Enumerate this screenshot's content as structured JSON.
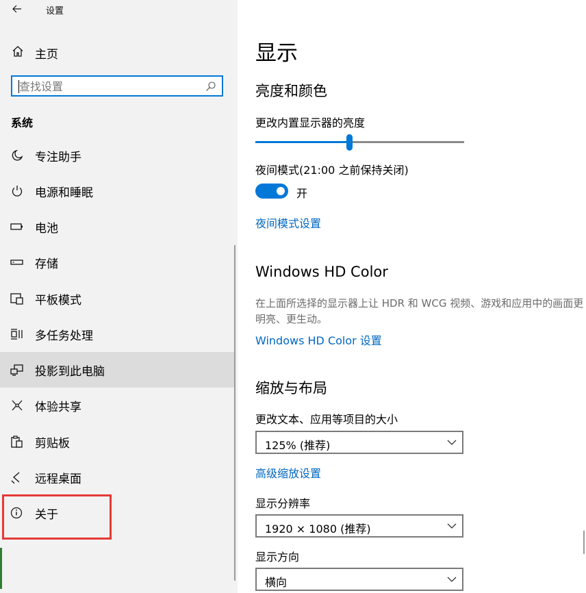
{
  "window": {
    "title": "设置",
    "back_icon": "back-arrow-icon"
  },
  "sidebar": {
    "home_label": "主页",
    "search_placeholder": "查找设置",
    "section_title": "系统",
    "items": [
      {
        "label": "专注助手",
        "icon": "moon-icon"
      },
      {
        "label": "电源和睡眠",
        "icon": "power-icon"
      },
      {
        "label": "电池",
        "icon": "battery-icon"
      },
      {
        "label": "存储",
        "icon": "storage-icon"
      },
      {
        "label": "平板模式",
        "icon": "tablet-mode-icon"
      },
      {
        "label": "多任务处理",
        "icon": "multitasking-icon"
      },
      {
        "label": "投影到此电脑",
        "icon": "projecting-icon",
        "selected": true
      },
      {
        "label": "体验共享",
        "icon": "shared-experiences-icon"
      },
      {
        "label": "剪贴板",
        "icon": "clipboard-icon"
      },
      {
        "label": "远程桌面",
        "icon": "remote-desktop-icon"
      },
      {
        "label": "关于",
        "icon": "info-icon"
      }
    ],
    "highlight_color": "#e53935"
  },
  "main": {
    "page_title": "显示",
    "brightness_section": {
      "heading": "亮度和颜色",
      "slider_label": "更改内置显示器的亮度",
      "brightness_level": 0.45,
      "night_light_label": "夜间模式(21:00 之前保持关闭)",
      "night_light_state": "开",
      "night_light_on": true,
      "night_light_settings_link": "夜间模式设置"
    },
    "hdr_section": {
      "heading": "Windows HD Color",
      "description": "在上面所选择的显示器上让 HDR 和 WCG 视频、游戏和应用中的画面更明亮、更生动。",
      "settings_link": "Windows HD Color 设置"
    },
    "scale_section": {
      "heading": "缩放与布局",
      "scale_label": "更改文本、应用等项目的大小",
      "scale_value": "125% (推荐)",
      "advanced_scaling_link": "高级缩放设置",
      "resolution_label": "显示分辨率",
      "resolution_value": "1920 × 1080 (推荐)",
      "orientation_label": "显示方向",
      "orientation_value": "横向"
    }
  },
  "colors": {
    "accent": "#0078d7",
    "link": "#0067c0",
    "sidebar_bg": "#f2f2f2",
    "selected_bg": "#dcdcdc"
  }
}
